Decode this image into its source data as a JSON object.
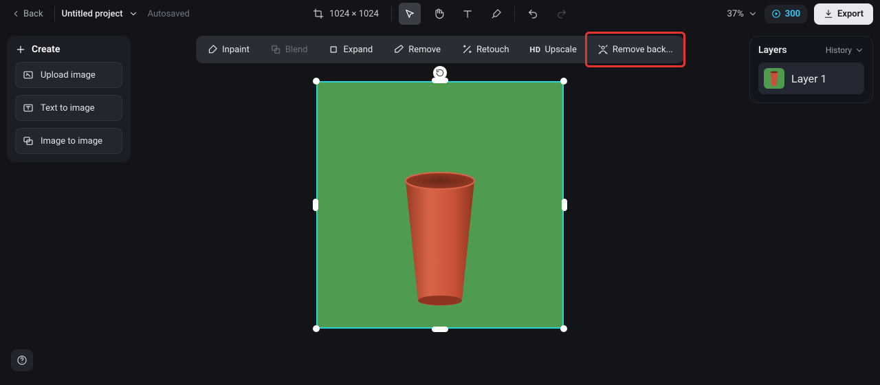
{
  "header": {
    "back": "Back",
    "project_name": "Untitled project",
    "autosaved": "Autosaved",
    "dimensions": "1024 × 1024",
    "zoom": "37%",
    "credits": "300",
    "export": "Export"
  },
  "create": {
    "title": "Create",
    "upload": "Upload image",
    "t2i": "Text to image",
    "i2i": "Image to image"
  },
  "toolbar": {
    "inpaint": "Inpaint",
    "blend": "Blend",
    "expand": "Expand",
    "remove": "Remove",
    "retouch": "Retouch",
    "upscale": "Upscale",
    "remove_bg": "Remove back..."
  },
  "layers": {
    "title": "Layers",
    "history": "History",
    "items": [
      {
        "label": "Layer 1"
      }
    ]
  },
  "canvas": {
    "bg_color": "#4f9b4f",
    "object": "terracotta-cup"
  }
}
